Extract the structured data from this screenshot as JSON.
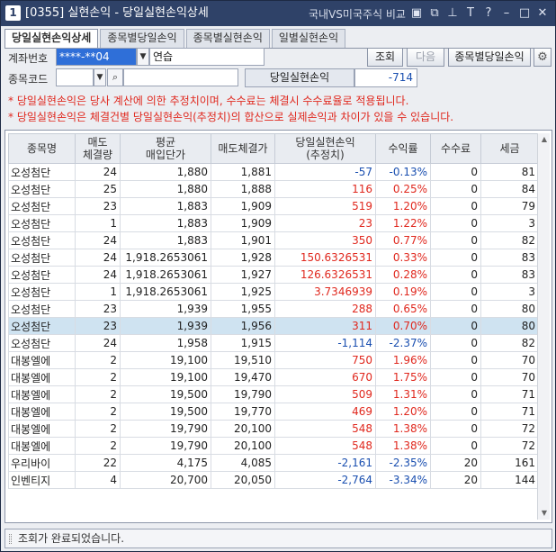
{
  "window": {
    "number": "1",
    "title": "[0355] 실현손익 - 당일실현손익상세",
    "compare_link": "국내VS미국주식 비교",
    "title_icons": [
      "window-icon",
      "restore-window-icon",
      "pin-icon",
      "font-size-icon",
      "help-icon",
      "minimize-icon",
      "maximize-icon",
      "close-icon"
    ]
  },
  "tabs": [
    {
      "label": "당일실현손익상세",
      "active": true
    },
    {
      "label": "종목별당일손익",
      "active": false
    },
    {
      "label": "종목별실현손익",
      "active": false
    },
    {
      "label": "일별실현손익",
      "active": false
    }
  ],
  "form": {
    "account_label": "계좌번호",
    "account_value": "****-**04",
    "account_name": "연습",
    "query_button": "조회",
    "next_button": "다음",
    "item_daily_button": "종목별당일손익",
    "code_label": "종목코드",
    "code_value": "",
    "name_value": "",
    "pnl_label": "당일실현손익",
    "pnl_value": "-714"
  },
  "notes": [
    "* 당일실현손익은 당사 계산에 의한 추정치이며, 수수료는 체결시 수수료율로 적용됩니다.",
    "* 당일실현손익은 체결건별 당일실현손익(추정치)의 합산으로 실제손익과 차이가 있을 수 있습니다."
  ],
  "table": {
    "headers": [
      {
        "l1": "종목명",
        "l2": ""
      },
      {
        "l1": "매도",
        "l2": "체결량"
      },
      {
        "l1": "평균",
        "l2": "매입단가"
      },
      {
        "l1": "매도체결가",
        "l2": ""
      },
      {
        "l1": "당일실현손익",
        "l2": "(추정치)"
      },
      {
        "l1": "수익률",
        "l2": ""
      },
      {
        "l1": "수수료",
        "l2": ""
      },
      {
        "l1": "세금",
        "l2": ""
      }
    ],
    "rows": [
      {
        "name": "오성첨단",
        "qty": "24",
        "avg": "1,880",
        "sell": "1,881",
        "pnl": "-57",
        "rate": "-0.13%",
        "fee": "0",
        "tax": "81",
        "sign": "neg",
        "selected": false
      },
      {
        "name": "오성첨단",
        "qty": "25",
        "avg": "1,880",
        "sell": "1,888",
        "pnl": "116",
        "rate": "0.25%",
        "fee": "0",
        "tax": "84",
        "sign": "pos",
        "selected": false
      },
      {
        "name": "오성첨단",
        "qty": "23",
        "avg": "1,883",
        "sell": "1,909",
        "pnl": "519",
        "rate": "1.20%",
        "fee": "0",
        "tax": "79",
        "sign": "pos",
        "selected": false
      },
      {
        "name": "오성첨단",
        "qty": "1",
        "avg": "1,883",
        "sell": "1,909",
        "pnl": "23",
        "rate": "1.22%",
        "fee": "0",
        "tax": "3",
        "sign": "pos",
        "selected": false
      },
      {
        "name": "오성첨단",
        "qty": "24",
        "avg": "1,883",
        "sell": "1,901",
        "pnl": "350",
        "rate": "0.77%",
        "fee": "0",
        "tax": "82",
        "sign": "pos",
        "selected": false
      },
      {
        "name": "오성첨단",
        "qty": "24",
        "avg": "1,918.2653061",
        "sell": "1,928",
        "pnl": "150.6326531",
        "rate": "0.33%",
        "fee": "0",
        "tax": "83",
        "sign": "pos",
        "selected": false
      },
      {
        "name": "오성첨단",
        "qty": "24",
        "avg": "1,918.2653061",
        "sell": "1,927",
        "pnl": "126.6326531",
        "rate": "0.28%",
        "fee": "0",
        "tax": "83",
        "sign": "pos",
        "selected": false
      },
      {
        "name": "오성첨단",
        "qty": "1",
        "avg": "1,918.2653061",
        "sell": "1,925",
        "pnl": "3.7346939",
        "rate": "0.19%",
        "fee": "0",
        "tax": "3",
        "sign": "pos",
        "selected": false
      },
      {
        "name": "오성첨단",
        "qty": "23",
        "avg": "1,939",
        "sell": "1,955",
        "pnl": "288",
        "rate": "0.65%",
        "fee": "0",
        "tax": "80",
        "sign": "pos",
        "selected": false
      },
      {
        "name": "오성첨단",
        "qty": "23",
        "avg": "1,939",
        "sell": "1,956",
        "pnl": "311",
        "rate": "0.70%",
        "fee": "0",
        "tax": "80",
        "sign": "pos",
        "selected": true
      },
      {
        "name": "오성첨단",
        "qty": "24",
        "avg": "1,958",
        "sell": "1,915",
        "pnl": "-1,114",
        "rate": "-2.37%",
        "fee": "0",
        "tax": "82",
        "sign": "neg",
        "selected": false
      },
      {
        "name": "대봉엘에",
        "qty": "2",
        "avg": "19,100",
        "sell": "19,510",
        "pnl": "750",
        "rate": "1.96%",
        "fee": "0",
        "tax": "70",
        "sign": "pos",
        "selected": false
      },
      {
        "name": "대봉엘에",
        "qty": "2",
        "avg": "19,100",
        "sell": "19,470",
        "pnl": "670",
        "rate": "1.75%",
        "fee": "0",
        "tax": "70",
        "sign": "pos",
        "selected": false
      },
      {
        "name": "대봉엘에",
        "qty": "2",
        "avg": "19,500",
        "sell": "19,790",
        "pnl": "509",
        "rate": "1.31%",
        "fee": "0",
        "tax": "71",
        "sign": "pos",
        "selected": false
      },
      {
        "name": "대봉엘에",
        "qty": "2",
        "avg": "19,500",
        "sell": "19,770",
        "pnl": "469",
        "rate": "1.20%",
        "fee": "0",
        "tax": "71",
        "sign": "pos",
        "selected": false
      },
      {
        "name": "대봉엘에",
        "qty": "2",
        "avg": "19,790",
        "sell": "20,100",
        "pnl": "548",
        "rate": "1.38%",
        "fee": "0",
        "tax": "72",
        "sign": "pos",
        "selected": false
      },
      {
        "name": "대봉엘에",
        "qty": "2",
        "avg": "19,790",
        "sell": "20,100",
        "pnl": "548",
        "rate": "1.38%",
        "fee": "0",
        "tax": "72",
        "sign": "pos",
        "selected": false
      },
      {
        "name": "우리바이",
        "qty": "22",
        "avg": "4,175",
        "sell": "4,085",
        "pnl": "-2,161",
        "rate": "-2.35%",
        "fee": "20",
        "tax": "161",
        "sign": "neg",
        "selected": false
      },
      {
        "name": "인벤티지",
        "qty": "4",
        "avg": "20,700",
        "sell": "20,050",
        "pnl": "-2,764",
        "rate": "-3.34%",
        "fee": "20",
        "tax": "144",
        "sign": "neg",
        "selected": false
      }
    ]
  },
  "status": {
    "message": "조회가 완료되었습니다."
  },
  "colors": {
    "positive": "#e0281e",
    "negative": "#1a4fb0",
    "selected_row": "#cfe3f1",
    "title_bar": "#2f4268"
  }
}
